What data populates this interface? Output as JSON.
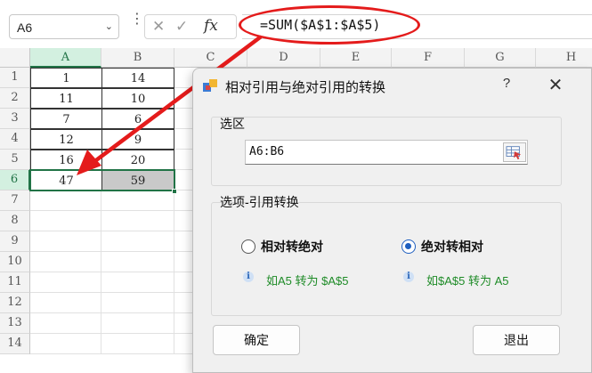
{
  "formula_bar": {
    "name_box": "A6",
    "name_box_icon": "chevron-down-icon",
    "cancel_icon": "✕",
    "enter_icon": "✓",
    "fx_label": "fx",
    "formula": "=SUM($A$1:$A$5)"
  },
  "sheet": {
    "columns": [
      "A",
      "B",
      "C",
      "D",
      "E",
      "F",
      "G",
      "H"
    ],
    "rows": [
      "1",
      "2",
      "3",
      "4",
      "5",
      "6",
      "7",
      "8",
      "9",
      "10",
      "11",
      "12",
      "13",
      "14"
    ],
    "selected_cell": "A6",
    "data": [
      {
        "a": "1",
        "b": "14"
      },
      {
        "a": "11",
        "b": "10"
      },
      {
        "a": "7",
        "b": "6"
      },
      {
        "a": "12",
        "b": "9"
      },
      {
        "a": "16",
        "b": "20"
      },
      {
        "a": "47",
        "b": "59"
      }
    ]
  },
  "annotation": {
    "color": "#e41b1b"
  },
  "dialog": {
    "title": "相对引用与绝对引用的转换",
    "help_label": "?",
    "close_label": "✕",
    "range_group": {
      "title": "选区",
      "value": "A6:B6"
    },
    "option_group": {
      "title": "选项-引用转换",
      "option1": {
        "label": "相对转绝对",
        "hint": "如A5 转为 $A$5",
        "selected": false
      },
      "option2": {
        "label": "绝对转相对",
        "hint": "如$A$5 转为 A5",
        "selected": true
      }
    },
    "ok_label": "确定",
    "cancel_label": "退出"
  }
}
